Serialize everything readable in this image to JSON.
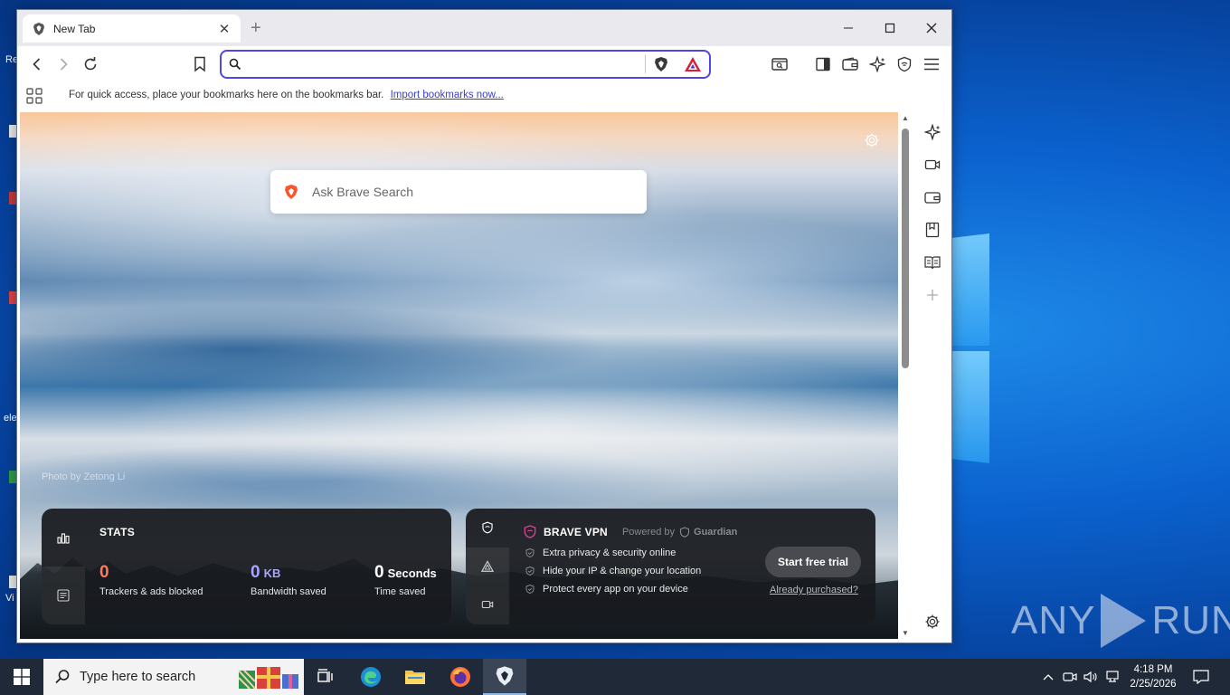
{
  "desktop": {
    "fragments": [
      "Re",
      "ele",
      "Vi"
    ],
    "watermark": "ANY RUN"
  },
  "browser": {
    "tab": {
      "title": "New Tab"
    },
    "omnibox": {
      "value": "",
      "placeholder": ""
    },
    "bookmarks_bar": {
      "message": "For quick access, place your bookmarks here on the bookmarks bar.",
      "import_link": "Import bookmarks now..."
    },
    "new_tab_page": {
      "photo_credit": "Photo by Zetong Li",
      "search_placeholder": "Ask Brave Search",
      "stats": {
        "title": "STATS",
        "trackers": {
          "value": "0",
          "label": "Trackers & ads blocked"
        },
        "bandwidth": {
          "value": "0",
          "unit": "KB",
          "label": "Bandwidth saved"
        },
        "time": {
          "value": "0",
          "unit": "Seconds",
          "label": "Time saved"
        }
      },
      "vpn": {
        "title": "BRAVE VPN",
        "powered_by": "Powered by",
        "partner": "Guardian",
        "features": [
          "Extra privacy & security online",
          "Hide your IP & change your location",
          "Protect every app on your device"
        ],
        "cta": "Start free trial",
        "already": "Already purchased?"
      }
    }
  },
  "taskbar": {
    "search_placeholder": "Type here to search",
    "time": "4:18 PM",
    "date": "2/25/2026"
  },
  "colors": {
    "accent": "#4f46e5",
    "brave_orange": "#fb542b",
    "stat_orange": "#ff7a59",
    "stat_purple": "#a8a5ff",
    "vpn_pink": "#d53f8c",
    "taskbar": "#1f2937"
  }
}
